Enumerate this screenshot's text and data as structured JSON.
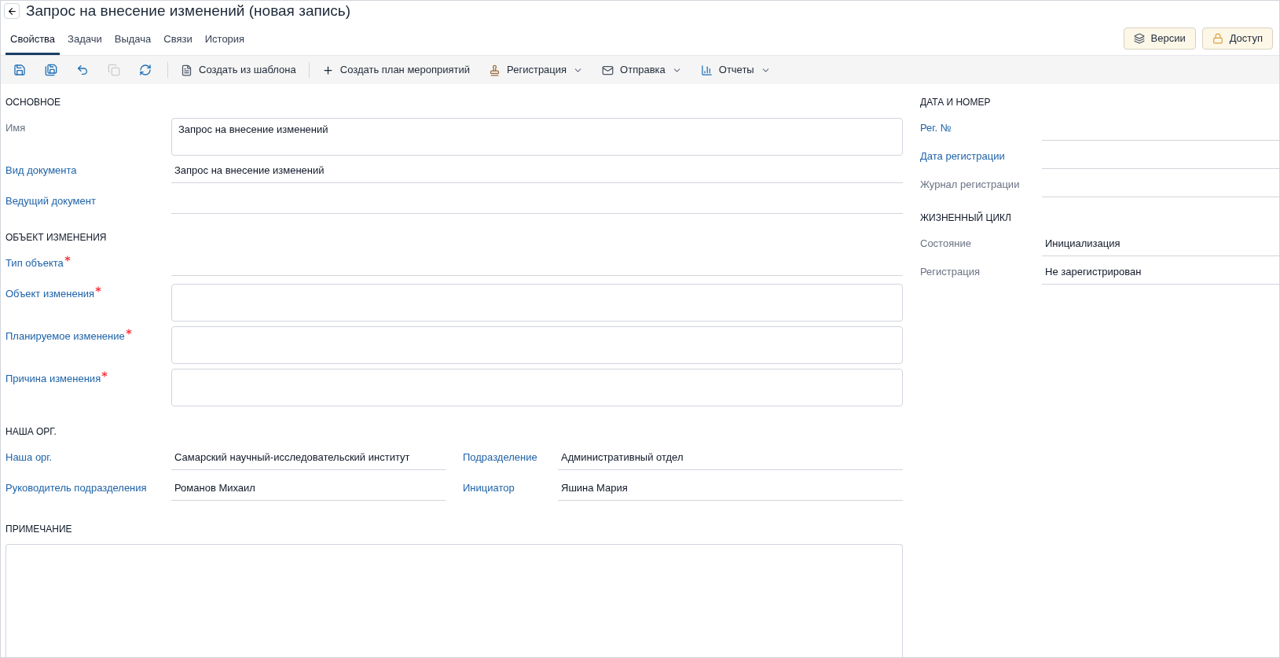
{
  "window": {
    "title": "Запрос на внесение изменений (новая запись)"
  },
  "tabs": [
    {
      "label": "Свойства",
      "selected": true
    },
    {
      "label": "Задачи",
      "selected": false
    },
    {
      "label": "Выдача",
      "selected": false
    },
    {
      "label": "Связи",
      "selected": false
    },
    {
      "label": "История",
      "selected": false
    }
  ],
  "header_buttons": [
    {
      "label": "Версии"
    },
    {
      "label": "Доступ"
    }
  ],
  "toolbar": {
    "icon_buttons": [
      {
        "disabled": false
      },
      {
        "disabled": false
      },
      {
        "disabled": false
      },
      {
        "disabled": true
      },
      {
        "disabled": false
      }
    ],
    "buttons": [
      {
        "label": "Создать из шаблона",
        "dropdown": false
      },
      {
        "label": "Создать план мероприятий",
        "dropdown": false
      },
      {
        "label": "Регистрация",
        "dropdown": true
      },
      {
        "label": "Отправка",
        "dropdown": true
      },
      {
        "label": "Отчеты",
        "dropdown": true
      }
    ]
  },
  "main_sections": [
    {
      "title": "ОСНОВНОЕ",
      "fields": [
        {
          "label": "Имя",
          "linked": false,
          "required": false,
          "kind": "area",
          "value": "Запрос на внесение изменений"
        },
        {
          "label": "Вид документа",
          "linked": true,
          "required": false,
          "kind": "line",
          "value": "Запрос на внесение изменений"
        },
        {
          "label": "Ведущий документ",
          "linked": true,
          "required": false,
          "kind": "line"
        }
      ]
    },
    {
      "title": "ОБЪЕКТ ИЗМЕНЕНИЯ",
      "fields": [
        {
          "label": "Тип объекта",
          "linked": true,
          "required": true,
          "kind": "line"
        },
        {
          "label": "Объект изменения",
          "linked": true,
          "required": true,
          "kind": "area"
        },
        {
          "label": "Планируемое изменение",
          "linked": true,
          "required": true,
          "kind": "area"
        },
        {
          "label": "Причина изменения",
          "linked": true,
          "required": true,
          "kind": "area"
        }
      ]
    }
  ],
  "org_section": {
    "title": "НАША ОРГ.",
    "fields": [
      {
        "label": "Наша орг.",
        "linked": true,
        "value": "Самарский научный-исследовательский институт"
      },
      {
        "label": "Подразделение",
        "linked": true,
        "value": "Административный отдел"
      },
      {
        "label": "Руководитель подразделения",
        "linked": true,
        "value": "Романов Михаил"
      },
      {
        "label": "Инициатор",
        "linked": true,
        "value": "Яшина Мария"
      }
    ]
  },
  "note_section": {
    "title": "ПРИМЕЧАНИЕ"
  },
  "side_sections": [
    {
      "title": "ДАТА И НОМЕР",
      "fields": [
        {
          "label": "Рег. №",
          "linked": true
        },
        {
          "label": "Дата регистрации",
          "linked": true
        },
        {
          "label": "Журнал регистрации",
          "linked": false
        }
      ]
    },
    {
      "title": "ЖИЗНЕННЫЙ ЦИКЛ",
      "fields": [
        {
          "label": "Состояние",
          "linked": false,
          "value": "Инициализация"
        },
        {
          "label": "Регистрация",
          "linked": false,
          "value": "Не зарегистрирован"
        }
      ]
    }
  ]
}
